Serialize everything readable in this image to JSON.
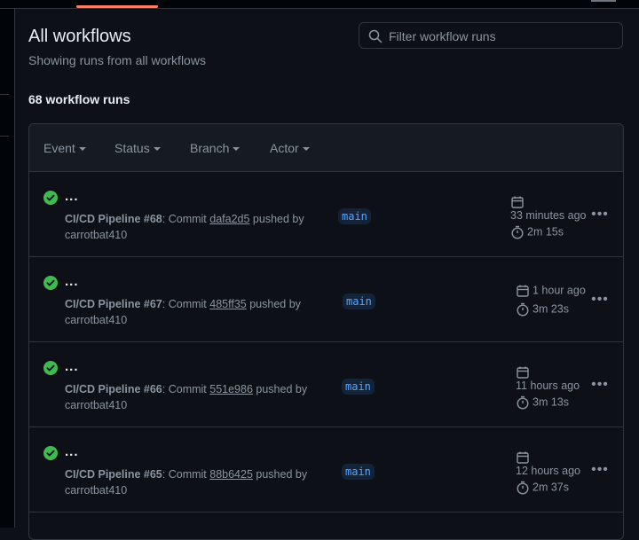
{
  "header": {
    "title": "All workflows",
    "subtitle": "Showing runs from all workflows",
    "search_placeholder": "Filter workflow runs",
    "runs_count": "68 workflow runs"
  },
  "filters": [
    "Event",
    "Status",
    "Branch",
    "Actor"
  ],
  "runs": [
    {
      "title": "...",
      "workflow": "CI/CD Pipeline #68",
      "desc_a": ": Commit ",
      "sha": "dafa2d5",
      "desc_b": " pushed by",
      "actor": "carrotbat410",
      "branch": "main",
      "time": "33 minutes ago",
      "duration": "2m 15s",
      "status": "success"
    },
    {
      "title": "...",
      "workflow": "CI/CD Pipeline #67",
      "desc_a": ": Commit ",
      "sha": "485ff35",
      "desc_b": " pushed by",
      "actor": "carrotbat410",
      "branch": "main",
      "time": "1 hour ago",
      "duration": "3m 23s",
      "status": "success"
    },
    {
      "title": "...",
      "workflow": "CI/CD Pipeline #66",
      "desc_a": ": Commit ",
      "sha": "551e986",
      "desc_b": " pushed by",
      "actor": "carrotbat410",
      "branch": "main",
      "time": "11 hours ago",
      "duration": "3m 13s",
      "status": "success"
    },
    {
      "title": "...",
      "workflow": "CI/CD Pipeline #65",
      "desc_a": ": Commit ",
      "sha": "88b6425",
      "desc_b": " pushed by",
      "actor": "carrotbat410",
      "branch": "main",
      "time": "12 hours ago",
      "duration": "2m 37s",
      "status": "success"
    }
  ],
  "colors": {
    "success": "#3fb950",
    "accent": "#f78166",
    "link": "#58a6ff"
  }
}
